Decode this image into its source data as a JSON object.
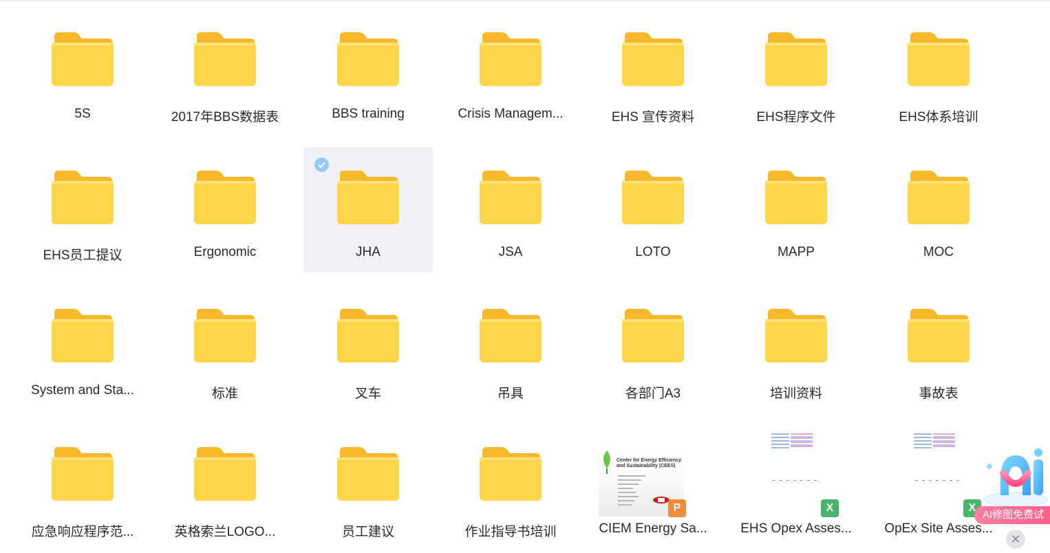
{
  "items": [
    {
      "type": "folder",
      "name": "5S"
    },
    {
      "type": "folder",
      "name": "2017年BBS数据表"
    },
    {
      "type": "folder",
      "name": "BBS training"
    },
    {
      "type": "folder",
      "name": "Crisis Managem..."
    },
    {
      "type": "folder",
      "name": "EHS 宣传资料"
    },
    {
      "type": "folder",
      "name": "EHS程序文件"
    },
    {
      "type": "folder",
      "name": "EHS体系培训"
    },
    {
      "type": "folder",
      "name": "EHS员工提议"
    },
    {
      "type": "folder",
      "name": "Ergonomic"
    },
    {
      "type": "folder",
      "name": "JHA",
      "selected": true
    },
    {
      "type": "folder",
      "name": "JSA"
    },
    {
      "type": "folder",
      "name": "LOTO"
    },
    {
      "type": "folder",
      "name": "MAPP"
    },
    {
      "type": "folder",
      "name": "MOC"
    },
    {
      "type": "folder",
      "name": "System and Sta..."
    },
    {
      "type": "folder",
      "name": "标准"
    },
    {
      "type": "folder",
      "name": "叉车"
    },
    {
      "type": "folder",
      "name": "吊具"
    },
    {
      "type": "folder",
      "name": "各部门A3"
    },
    {
      "type": "folder",
      "name": "培训资料"
    },
    {
      "type": "folder",
      "name": "事故表"
    },
    {
      "type": "folder",
      "name": "应急响应程序范..."
    },
    {
      "type": "folder",
      "name": "英格索兰LOGO..."
    },
    {
      "type": "folder",
      "name": "员工建议"
    },
    {
      "type": "folder",
      "name": "作业指导书培训"
    },
    {
      "type": "ppt",
      "name": "CIEM Energy Sa...",
      "badge": "P",
      "thumb_title": "Center for Energy Efficiency and Sustainability (CEES)"
    },
    {
      "type": "xls",
      "name": "EHS Opex Asses...",
      "badge": "X"
    },
    {
      "type": "xls",
      "name": "OpEx Site Asses...",
      "badge": "X"
    }
  ],
  "promo": {
    "text": "AI修图免费试",
    "close": "✕"
  },
  "colors": {
    "folder_back": "#f7b92b",
    "folder_front": "#ffd54a",
    "selected_bg": "#f1f2f8",
    "check": "#4aa8f5"
  }
}
